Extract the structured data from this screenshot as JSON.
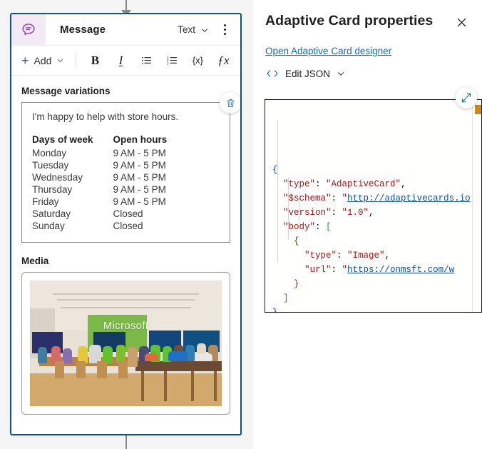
{
  "node": {
    "icon": "message-bubble-icon",
    "title": "Message",
    "type_selector": "Text",
    "type_chevron": "chevron-down-icon",
    "overflow_menu": "more-options-icon",
    "toolbar": {
      "add_label": "Add",
      "add_plus": "+",
      "add_chevron": "chevron-down-icon",
      "bold": "B",
      "italic": "I",
      "bullet_list": "bulleted-list-icon",
      "numbered_list": "numbered-list-icon",
      "variable": "{x}",
      "formula": "ƒx"
    },
    "variations": {
      "label": "Message variations",
      "delete_icon": "trash-icon",
      "intro_text": "I'm happy to help with store hours.",
      "table": {
        "headers": [
          "Days of week",
          "Open hours"
        ],
        "rows": [
          [
            "Monday",
            "9 AM - 5 PM"
          ],
          [
            "Tuesday",
            "9 AM - 5 PM"
          ],
          [
            "Wednesday",
            "9 AM - 5 PM"
          ],
          [
            "Thursday",
            "9 AM - 5 PM"
          ],
          [
            "Friday",
            "9 AM - 5 PM"
          ],
          [
            "Saturday",
            "Closed"
          ],
          [
            "Sunday",
            "Closed"
          ]
        ]
      }
    },
    "media": {
      "label": "Media",
      "image_alt": "Microsoft",
      "store_sign_text": "Microsoft"
    }
  },
  "properties_panel": {
    "title": "Adaptive Card properties",
    "close_icon": "close-icon",
    "designer_link": "Open Adaptive Card designer",
    "edit_json_icon": "code-brackets-icon",
    "edit_json_label": "Edit JSON",
    "edit_json_chevron": "chevron-down-icon",
    "expand_icon": "expand-diagonal-icon",
    "json_lines": [
      {
        "indent": 0,
        "tokens": [
          {
            "c": "b1",
            "t": "{"
          }
        ]
      },
      {
        "indent": 1,
        "tokens": [
          {
            "c": "k",
            "t": "\"type\""
          },
          {
            "c": "p",
            "t": ": "
          },
          {
            "c": "s",
            "t": "\"AdaptiveCard\""
          },
          {
            "c": "p",
            "t": ","
          }
        ]
      },
      {
        "indent": 1,
        "tokens": [
          {
            "c": "k",
            "t": "\"$schema\""
          },
          {
            "c": "p",
            "t": ": "
          },
          {
            "c": "s",
            "t": "\""
          },
          {
            "c": "lnk",
            "t": "http://adaptivecards.io"
          }
        ]
      },
      {
        "indent": 1,
        "tokens": [
          {
            "c": "k",
            "t": "\"version\""
          },
          {
            "c": "p",
            "t": ": "
          },
          {
            "c": "s",
            "t": "\"1.0\""
          },
          {
            "c": "p",
            "t": ","
          }
        ]
      },
      {
        "indent": 1,
        "tokens": [
          {
            "c": "k",
            "t": "\"body\""
          },
          {
            "c": "p",
            "t": ": "
          },
          {
            "c": "b2",
            "t": "["
          }
        ]
      },
      {
        "indent": 2,
        "tokens": [
          {
            "c": "b3",
            "t": "{"
          }
        ]
      },
      {
        "indent": 3,
        "tokens": [
          {
            "c": "k",
            "t": "\"type\""
          },
          {
            "c": "p",
            "t": ": "
          },
          {
            "c": "s",
            "t": "\"Image\""
          },
          {
            "c": "p",
            "t": ","
          }
        ]
      },
      {
        "indent": 3,
        "tokens": [
          {
            "c": "k",
            "t": "\"url\""
          },
          {
            "c": "p",
            "t": ": "
          },
          {
            "c": "s",
            "t": "\""
          },
          {
            "c": "lnk",
            "t": "https://onmsft.com/w"
          }
        ]
      },
      {
        "indent": 2,
        "tokens": [
          {
            "c": "b3",
            "t": "}"
          }
        ]
      },
      {
        "indent": 1,
        "tokens": [
          {
            "c": "b2",
            "t": "]"
          }
        ]
      },
      {
        "indent": 0,
        "tokens": [
          {
            "c": "b1",
            "t": "}"
          }
        ]
      }
    ]
  },
  "colors": {
    "node_border": "#13566e",
    "node_icon": "#8a3bb0",
    "node_icon_bg": "#f3eaf7",
    "link": "#0f6cbd",
    "accent_teal": "#13566e",
    "minimap_mark": "#c98a16"
  }
}
